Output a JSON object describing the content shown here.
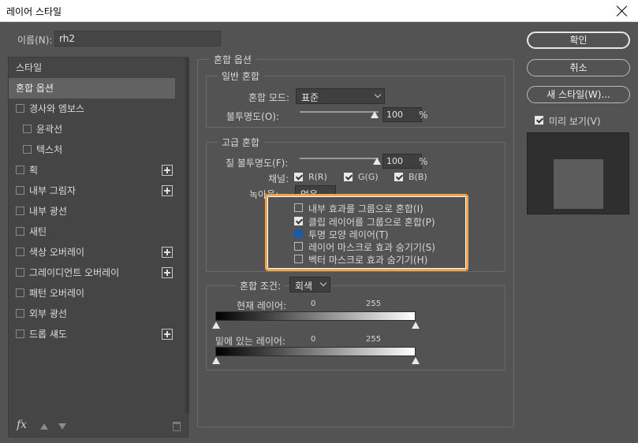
{
  "window": {
    "title": "레이어 스타일"
  },
  "name_field": {
    "label": "이름(N):",
    "value": "rh2"
  },
  "styles_list": {
    "items": [
      {
        "label": "스타일",
        "checkbox": false,
        "plus": false,
        "selected": false,
        "indent": false
      },
      {
        "label": "혼합 옵션",
        "checkbox": false,
        "plus": false,
        "selected": true,
        "indent": false
      },
      {
        "label": "경사와 엠보스",
        "checkbox": true,
        "plus": false,
        "selected": false,
        "indent": false
      },
      {
        "label": "윤곽선",
        "checkbox": true,
        "plus": false,
        "selected": false,
        "indent": true
      },
      {
        "label": "텍스처",
        "checkbox": true,
        "plus": false,
        "selected": false,
        "indent": true
      },
      {
        "label": "획",
        "checkbox": true,
        "plus": true,
        "selected": false,
        "indent": false
      },
      {
        "label": "내부 그림자",
        "checkbox": true,
        "plus": true,
        "selected": false,
        "indent": false
      },
      {
        "label": "내부 광선",
        "checkbox": true,
        "plus": false,
        "selected": false,
        "indent": false
      },
      {
        "label": "새틴",
        "checkbox": true,
        "plus": false,
        "selected": false,
        "indent": false
      },
      {
        "label": "색상 오버레이",
        "checkbox": true,
        "plus": true,
        "selected": false,
        "indent": false
      },
      {
        "label": "그레이디언트 오버레이",
        "checkbox": true,
        "plus": true,
        "selected": false,
        "indent": false
      },
      {
        "label": "패턴 오버레이",
        "checkbox": true,
        "plus": false,
        "selected": false,
        "indent": false
      },
      {
        "label": "외부 광선",
        "checkbox": true,
        "plus": false,
        "selected": false,
        "indent": false
      },
      {
        "label": "드롭 섀도",
        "checkbox": true,
        "plus": true,
        "selected": false,
        "indent": false
      }
    ],
    "fx_label": "fx"
  },
  "blending": {
    "section_title": "혼합 옵션",
    "general": {
      "title": "일반 혼합",
      "mode_label": "혼합 모드:",
      "mode_value": "표준",
      "opacity_label": "불투명도(O):",
      "opacity_value": "100",
      "unit": "%"
    },
    "advanced": {
      "title": "고급 혼합",
      "fill_label": "칠 불투명도(F):",
      "fill_value": "100",
      "unit": "%",
      "channels_label": "채널:",
      "channel_r": "R(R)",
      "channel_g": "G(G)",
      "channel_b": "B(B)",
      "knockout_label": "녹아웃:",
      "knockout_value": "없음",
      "options": [
        {
          "label": "내부 효과를 그룹으로 혼합(I)",
          "state": "unchecked"
        },
        {
          "label": "클립 레이어를 그룹으로 혼합(P)",
          "state": "checked"
        },
        {
          "label": "투명 모양 레이어(T)",
          "state": "blue"
        },
        {
          "label": "레이어 마스크로 효과 숨기기(S)",
          "state": "unchecked"
        },
        {
          "label": "벡터 마스크로 효과 숨기기(H)",
          "state": "unchecked"
        }
      ]
    },
    "blend_if": {
      "label": "혼합 조건:",
      "value": "회색",
      "this_layer_label": "현재 레이어:",
      "this_min": "0",
      "this_max": "255",
      "underlying_label": "밑에 있는 레이어:",
      "under_min": "0",
      "under_max": "255"
    }
  },
  "buttons": {
    "ok": "확인",
    "cancel": "취소",
    "new_style": "새 스타일(W)...",
    "preview_label": "미리 보기(V)"
  },
  "colors": {
    "highlight": "#f2a64a",
    "background": "#535353",
    "panel": "#454545"
  }
}
